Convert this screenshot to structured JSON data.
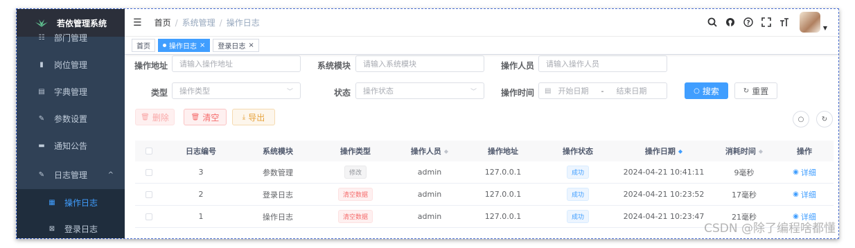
{
  "app": {
    "title": "若依管理系统"
  },
  "sidebar": {
    "items": [
      {
        "label": "部门管理",
        "icon": "tree-icon"
      },
      {
        "label": "岗位管理",
        "icon": "post-icon"
      },
      {
        "label": "字典管理",
        "icon": "dict-icon"
      },
      {
        "label": "参数设置",
        "icon": "edit-icon"
      },
      {
        "label": "通知公告",
        "icon": "message-icon"
      },
      {
        "label": "日志管理",
        "icon": "log-icon"
      },
      {
        "label": "操作日志",
        "icon": "form-icon"
      },
      {
        "label": "登录日志",
        "icon": "logininfor-icon"
      }
    ],
    "expand_arrow": "^"
  },
  "header": {
    "breadcrumb": [
      "首页",
      "系统管理",
      "操作日志"
    ],
    "separator": "/"
  },
  "tags": [
    {
      "label": "首页"
    },
    {
      "label": "操作日志",
      "active": true
    },
    {
      "label": "登录日志"
    }
  ],
  "search": {
    "oper_addr_label": "操作地址",
    "oper_addr_placeholder": "请输入操作地址",
    "module_label": "系统模块",
    "module_placeholder": "请输入系统模块",
    "oper_name_label": "操作人员",
    "oper_name_placeholder": "请输入操作人员",
    "type_label": "类型",
    "type_placeholder": "操作类型",
    "status_label": "状态",
    "status_placeholder": "操作状态",
    "time_label": "操作时间",
    "start_placeholder": "开始日期",
    "range_sep": "-",
    "end_placeholder": "结束日期",
    "search_btn": "搜索",
    "reset_btn": "重置"
  },
  "toolbar": {
    "delete": "删除",
    "clean": "清空",
    "export": "导出"
  },
  "table": {
    "headers": [
      "日志编号",
      "系统模块",
      "操作类型",
      "操作人员",
      "操作地址",
      "操作状态",
      "操作日期",
      "消耗时间",
      "操作"
    ],
    "rows": [
      {
        "id": "3",
        "module": "参数管理",
        "type": "修改",
        "type_style": "info",
        "user": "admin",
        "ip": "127.0.0.1",
        "status": "成功",
        "date": "2024-04-21 10:41:11",
        "cost": "9毫秒",
        "action": "详细"
      },
      {
        "id": "2",
        "module": "登录日志",
        "type": "清空数据",
        "type_style": "danger",
        "user": "admin",
        "ip": "127.0.0.1",
        "status": "成功",
        "date": "2024-04-21 10:23:52",
        "cost": "17毫秒",
        "action": "详细"
      },
      {
        "id": "1",
        "module": "操作日志",
        "type": "清空数据",
        "type_style": "danger",
        "user": "admin",
        "ip": "127.0.0.1",
        "status": "成功",
        "date": "2024-04-21 10:23:47",
        "cost": "21毫秒",
        "action": "详细"
      }
    ]
  },
  "watermark": "CSDN @除了编程啥都懂",
  "colors": {
    "sidebar": "#304156",
    "primary": "#409eff",
    "danger": "#f56c6c",
    "warning": "#e6a23c"
  }
}
